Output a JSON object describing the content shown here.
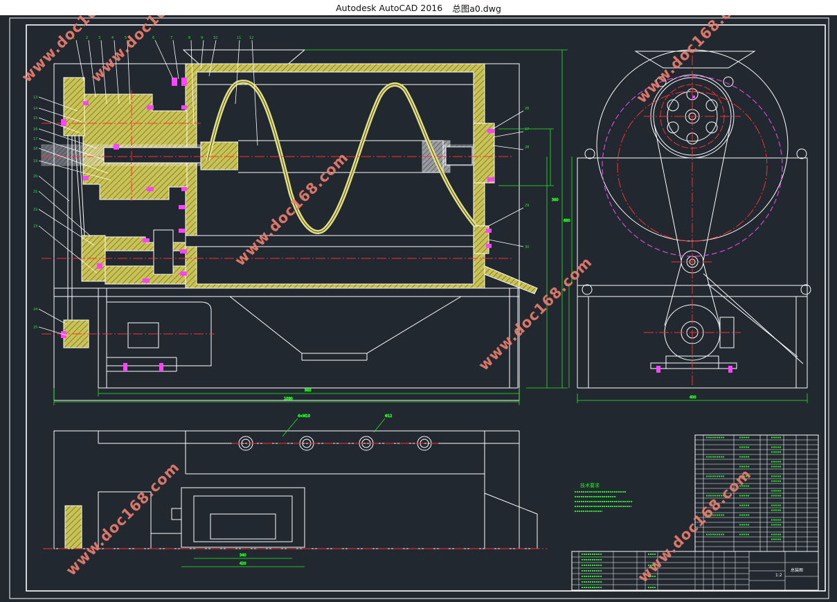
{
  "window": {
    "app_title": "Autodesk AutoCAD 2016",
    "document_name": "总图a0.dwg"
  },
  "watermark": {
    "text": "www.doc168.com",
    "color": "#f08070"
  },
  "colors": {
    "background": "#212830",
    "outline": "#ffffff",
    "dimension": "#22ee22",
    "centerline": "#ff3030",
    "section_hatch": "#e6e07a",
    "fastener": "#ff44ff",
    "pitch_circle": "#d84ad8"
  },
  "technical_requirements": {
    "heading": "技术要求",
    "lines": [
      "",
      "",
      "",
      "",
      ""
    ]
  },
  "title_block": {
    "drawing_title": "总装图",
    "scale": "1:2"
  }
}
